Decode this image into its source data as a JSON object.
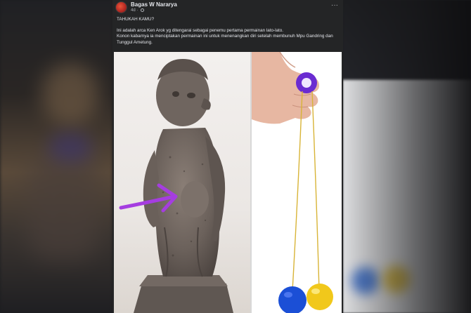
{
  "post": {
    "author": "Bagas W Nararya",
    "time": "4d",
    "more_label": "···",
    "caption_line1": "TAHUKAH KAMU?",
    "caption_line2": "Ini adalah arca Ken Arok yg ditengarai sebagai penemu pertama permainan lato-lato.",
    "caption_line3": "Konon kabarnya ia menciptakan permainan ini untuk menenangkan diri setelah membunuh Mpu Gandring dan Tunggul Ametung."
  },
  "colors": {
    "card_bg": "#242526",
    "text_primary": "#e4e6eb",
    "text_secondary": "#b0b3b8",
    "arrow": "#a53de0",
    "ball_blue": "#1b4fd6",
    "ball_yellow": "#f1c81b",
    "ring_purple": "#6a2bd1"
  },
  "icons": {
    "privacy": "globe-icon",
    "options": "more-horizontal-icon"
  }
}
